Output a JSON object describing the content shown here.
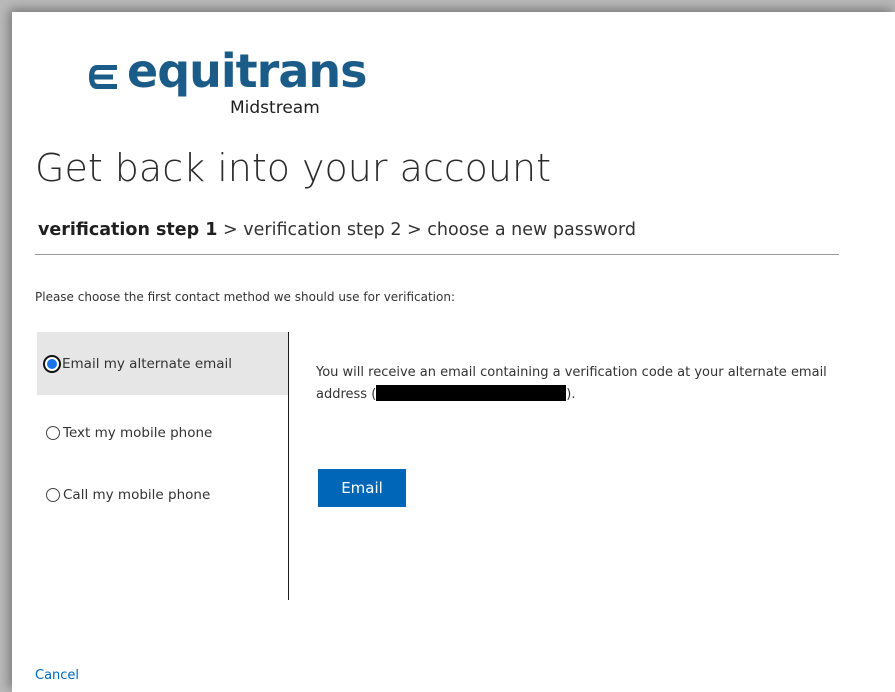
{
  "logo": {
    "word": "equitrans",
    "sub": "Midstream",
    "brand_color": "#1a5c87"
  },
  "title": "Get back into your account",
  "steps": {
    "current": "verification step 1",
    "separator": ">",
    "step2": "verification step 2",
    "step3": "choose a new password"
  },
  "instruction": "Please choose the first contact method we should use for verification:",
  "options": [
    {
      "label": "Email my alternate email",
      "selected": true
    },
    {
      "label": "Text my mobile phone",
      "selected": false
    },
    {
      "label": "Call my mobile phone",
      "selected": false
    }
  ],
  "detail": {
    "text_before": "You will receive an email containing a verification code at your alternate email address (",
    "text_after": ")."
  },
  "button": {
    "label": "Email",
    "color": "#0067b8"
  },
  "cancel_label": "Cancel"
}
